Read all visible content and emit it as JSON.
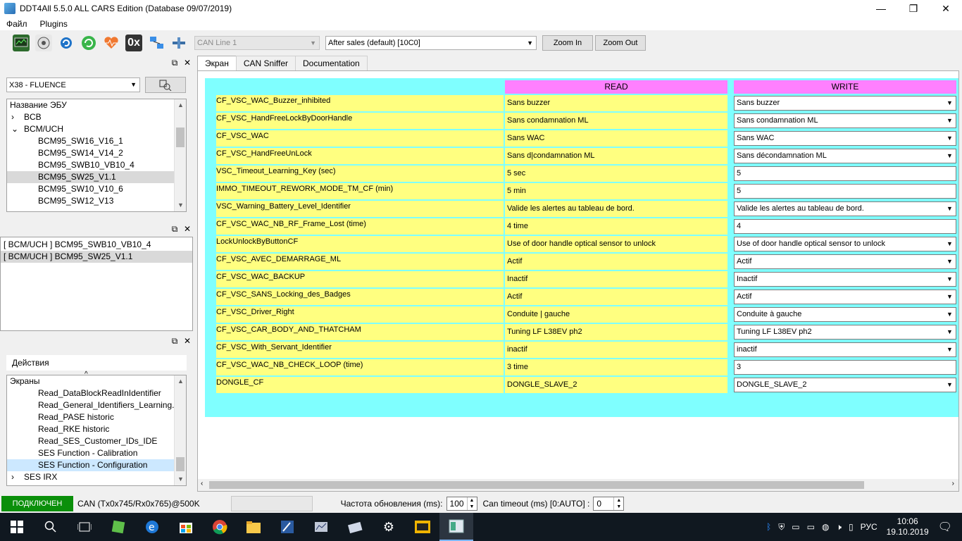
{
  "window": {
    "title": "DDT4All 5.5.0 ALL CARS Edition (Database 09/07/2019)",
    "minimize": "—",
    "restore": "❐",
    "close": "✕"
  },
  "menu": [
    "Файл",
    "Plugins"
  ],
  "toolbar": {
    "hex_label": "0x",
    "can_line": "CAN Line 1",
    "session": "After sales (default) [10C0]",
    "zoom_in": "Zoom In",
    "zoom_out": "Zoom Out"
  },
  "vehicle_panel": {
    "vehicle": "X38 - FLUENCE",
    "tree_header": "Название ЭБУ",
    "tree": [
      {
        "text": "BCB",
        "level": 0,
        "toggle": "›"
      },
      {
        "text": "BCM/UCH",
        "level": 0,
        "toggle": "⌄"
      },
      {
        "text": "BCM95_SW16_V16_1",
        "level": 1,
        "toggle": ""
      },
      {
        "text": "BCM95_SW14_V14_2",
        "level": 1,
        "toggle": ""
      },
      {
        "text": "BCM95_SWB10_VB10_4",
        "level": 1,
        "toggle": ""
      },
      {
        "text": "BCM95_SW25_V1.1",
        "level": 1,
        "toggle": "",
        "selected": true
      },
      {
        "text": "BCM95_SW10_V10_6",
        "level": 1,
        "toggle": ""
      },
      {
        "text": "BCM95_SW12_V13",
        "level": 1,
        "toggle": ""
      }
    ]
  },
  "ecu_list": [
    {
      "text": "[ BCM/UCH ] BCM95_SWB10_VB10_4",
      "selected": false
    },
    {
      "text": "[ BCM/UCH ] BCM95_SW25_V1.1",
      "selected": true
    }
  ],
  "actions_panel": {
    "title": "Действия",
    "tree_header": "Экраны",
    "items": [
      {
        "text": "Read_DataBlockReadInIdentifier",
        "level": 1
      },
      {
        "text": "Read_General_Identifiers_Learning...",
        "level": 1
      },
      {
        "text": "Read_PASE historic",
        "level": 1
      },
      {
        "text": "Read_RKE historic",
        "level": 1
      },
      {
        "text": "Read_SES_Customer_IDs_IDE",
        "level": 1
      },
      {
        "text": "SES Function - Calibration",
        "level": 1
      },
      {
        "text": "SES Function - Configuration",
        "level": 1,
        "selected": true
      },
      {
        "text": "SES IRX",
        "level": 0,
        "toggle": "›"
      }
    ]
  },
  "tabs": [
    {
      "label": "Экран",
      "active": true
    },
    {
      "label": "CAN Sniffer",
      "active": false
    },
    {
      "label": "Documentation",
      "active": false
    }
  ],
  "screen": {
    "read_header": "READ",
    "write_header": "WRITE",
    "rows": [
      {
        "label": "CF_VSC_WAC_Buzzer_inhibited",
        "read": "Sans buzzer",
        "write": "Sans buzzer",
        "dropdown": true
      },
      {
        "label": "CF_VSC_HandFreeLockByDoorHandle",
        "read": "Sans condamnation ML",
        "write": "Sans condamnation ML",
        "dropdown": true
      },
      {
        "label": "CF_VSC_WAC",
        "read": "Sans WAC",
        "write": "Sans WAC",
        "dropdown": true
      },
      {
        "label": "CF_VSC_HandFreeUnLock",
        "read": "Sans d|condamnation ML",
        "write": "Sans décondamnation ML",
        "dropdown": true
      },
      {
        "label": "VSC_Timeout_Learning_Key (sec)",
        "read": "5 sec",
        "write": "5",
        "dropdown": false
      },
      {
        "label": "IMMO_TIMEOUT_REWORK_MODE_TM_CF (min)",
        "read": "5 min",
        "write": "5",
        "dropdown": false
      },
      {
        "label": "VSC_Warning_Battery_Level_Identifier",
        "read": "Valide les alertes au tableau de bord.",
        "write": "Valide les alertes au tableau de bord.",
        "dropdown": true
      },
      {
        "label": "CF_VSC_WAC_NB_RF_Frame_Lost (time)",
        "read": "4 time",
        "write": "4",
        "dropdown": false
      },
      {
        "label": "LockUnlockByButtonCF",
        "read": "Use of door handle optical sensor to unlock",
        "write": "Use of door handle optical sensor to unlock",
        "dropdown": true
      },
      {
        "label": "CF_VSC_AVEC_DEMARRAGE_ML",
        "read": "Actif",
        "write": "Actif",
        "dropdown": true
      },
      {
        "label": "CF_VSC_WAC_BACKUP",
        "read": "Inactif",
        "write": "Inactif",
        "dropdown": true
      },
      {
        "label": "CF_VSC_SANS_Locking_des_Badges",
        "read": "Actif",
        "write": "Actif",
        "dropdown": true
      },
      {
        "label": "CF_VSC_Driver_Right",
        "read": "Conduite | gauche",
        "write": "Conduite à gauche",
        "dropdown": true
      },
      {
        "label": "CF_VSC_CAR_BODY_AND_THATCHAM",
        "read": "Tuning LF L38EV ph2",
        "write": "Tuning LF L38EV ph2",
        "dropdown": true
      },
      {
        "label": "CF_VSC_With_Servant_Identifier",
        "read": "inactif",
        "write": "inactif",
        "dropdown": true
      },
      {
        "label": "CF_VSC_WAC_NB_CHECK_LOOP (time)",
        "read": "3 time",
        "write": "3",
        "dropdown": false
      },
      {
        "label": "DONGLE_CF",
        "read": "DONGLE_SLAVE_2",
        "write": "DONGLE_SLAVE_2",
        "dropdown": true
      }
    ]
  },
  "status": {
    "connection": "ПОДКЛЮЧЕН",
    "can_info": "CAN (Tx0x745/Rx0x765)@500K",
    "refresh_label": "Частота обновления (ms):",
    "refresh_value": "100",
    "timeout_label": "Can timeout (ms) [0:AUTO] :",
    "timeout_value": "0"
  },
  "taskbar": {
    "language": "РУС",
    "time": "10:06",
    "date": "19.10.2019"
  },
  "colors": {
    "screen_bg": "#7fffff",
    "label_bg": "#ffff80",
    "header_bg": "#ff80ff",
    "connected": "#0a8f0a"
  }
}
